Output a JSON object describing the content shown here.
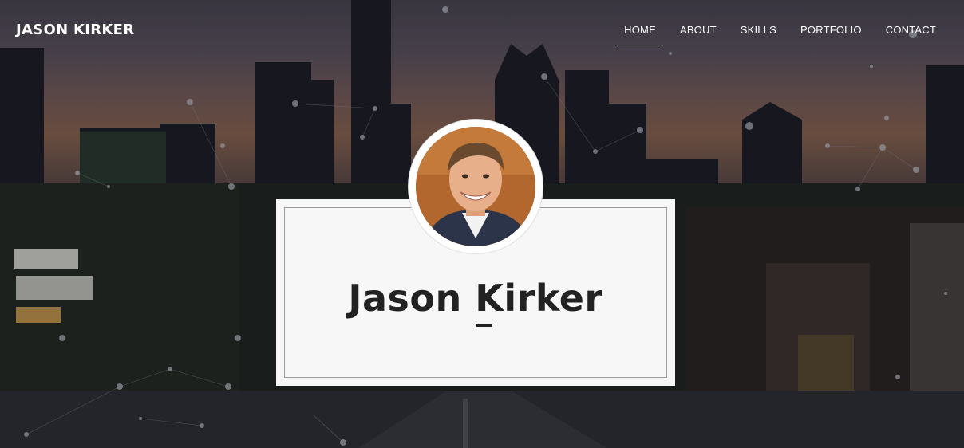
{
  "brand": {
    "name": "JASON KIRKER"
  },
  "nav": {
    "items": [
      {
        "label": "HOME",
        "active": true
      },
      {
        "label": "ABOUT",
        "active": false
      },
      {
        "label": "SKILLS",
        "active": false
      },
      {
        "label": "PORTFOLIO",
        "active": false
      },
      {
        "label": "CONTACT",
        "active": false
      }
    ]
  },
  "hero": {
    "name": "Jason Kirker",
    "avatar_icon": "profile-photo"
  },
  "colors": {
    "card_bg": "#f7f7f7",
    "text_dark": "#222222",
    "nav_text": "#ffffff"
  }
}
